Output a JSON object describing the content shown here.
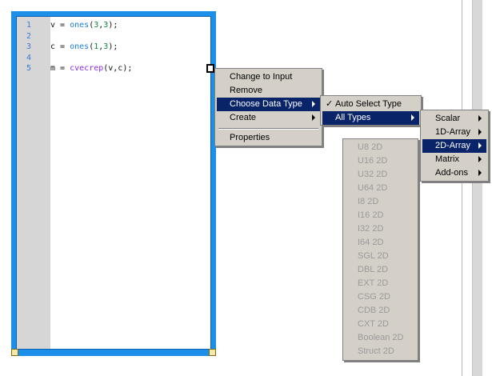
{
  "code_lines": [
    {
      "num": "1",
      "code": [
        {
          "t": "v = ",
          "c": ""
        },
        {
          "t": "ones",
          "c": "fn"
        },
        {
          "t": "(",
          "c": ""
        },
        {
          "t": "3",
          "c": "num"
        },
        {
          "t": ",",
          "c": ""
        },
        {
          "t": "3",
          "c": "num"
        },
        {
          "t": ");",
          "c": ""
        }
      ]
    },
    {
      "num": "2",
      "code": []
    },
    {
      "num": "3",
      "code": [
        {
          "t": "c = ",
          "c": ""
        },
        {
          "t": "ones",
          "c": "fn"
        },
        {
          "t": "(",
          "c": ""
        },
        {
          "t": "1",
          "c": "num"
        },
        {
          "t": ",",
          "c": ""
        },
        {
          "t": "3",
          "c": "num"
        },
        {
          "t": ");",
          "c": ""
        }
      ]
    },
    {
      "num": "4",
      "code": []
    },
    {
      "num": "5",
      "code": [
        {
          "t": "m = ",
          "c": ""
        },
        {
          "t": "cvecrep",
          "c": "fn2"
        },
        {
          "t": "(v,c);",
          "c": ""
        }
      ]
    }
  ],
  "context_menu": {
    "items": [
      "Change to Input",
      "Remove",
      "Choose Data Type",
      "Create",
      "Properties"
    ]
  },
  "data_type_menu": {
    "check_mark": "✓",
    "items": [
      "Auto Select Type",
      "All Types"
    ]
  },
  "all_types_menu": {
    "items": [
      "Scalar",
      "1D-Array",
      "2D-Array",
      "Matrix",
      "Add-ons"
    ]
  },
  "array2d_menu": {
    "items": [
      "U8 2D",
      "U16 2D",
      "U32 2D",
      "U64 2D",
      "I8 2D",
      "I16 2D",
      "I32 2D",
      "I64 2D",
      "SGL 2D",
      "DBL 2D",
      "EXT 2D",
      "CSG 2D",
      "CDB 2D",
      "CXT 2D",
      "Boolean 2D",
      "Struct 2D"
    ]
  },
  "colors": {
    "node_border": "#1c8fe8",
    "menu_bg": "#d4d0c8",
    "menu_highlight": "#0a246a"
  }
}
